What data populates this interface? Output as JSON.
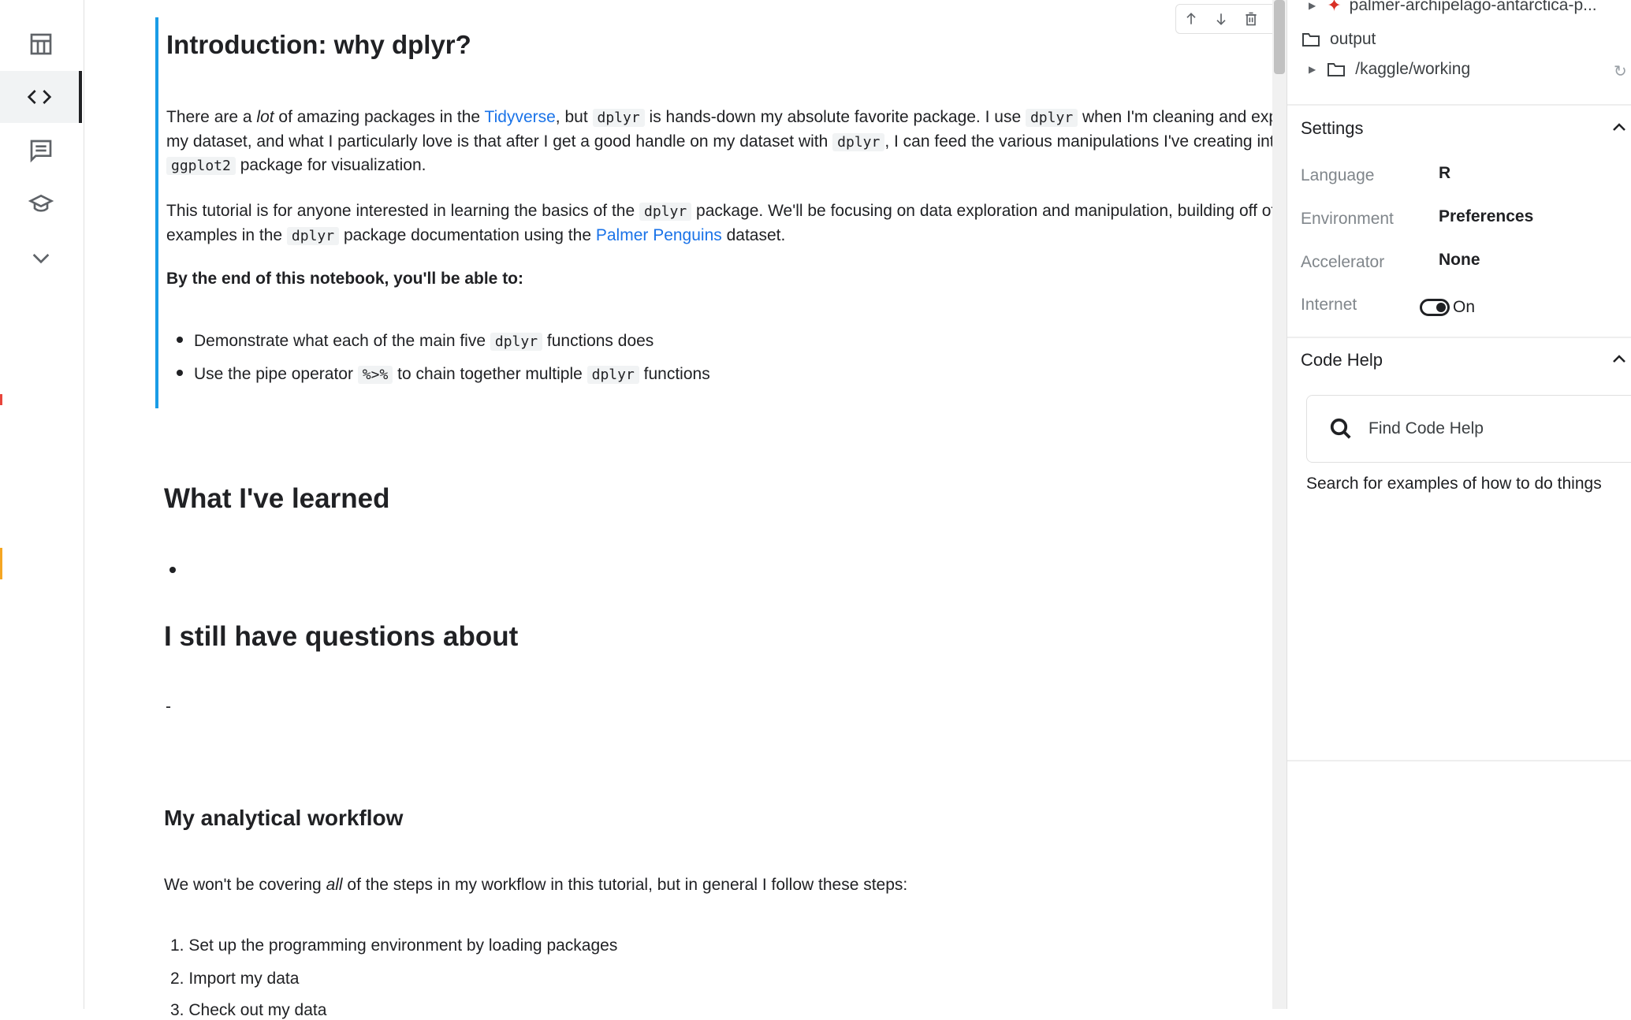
{
  "rail": {
    "items": [
      "table-icon",
      "code-icon",
      "comments-icon",
      "learn-icon",
      "expand-icon"
    ],
    "active": "code-icon"
  },
  "cell": {
    "toolbar": [
      "arrow-up-icon",
      "arrow-down-icon",
      "trash-icon",
      "collapse-icon",
      "more-icon"
    ],
    "title": "Introduction: why dplyr?",
    "p1": {
      "a": "There are a ",
      "em": "lot",
      "b": " of amazing packages in the ",
      "link1": "Tidyverse",
      "c": ", but ",
      "code1": "dplyr",
      "d": " is hands-down my absolute favorite package. I use ",
      "code2": "dplyr",
      "e": " when I'm cleaning and exploring my dataset, and what I particularly love is that after I get a good handle on my dataset with ",
      "code3": "dplyr",
      "f": ", I can feed the various manipulations I've creating into the ",
      "code4": "ggplot2",
      "g": " package for visualization."
    },
    "p2": {
      "a": "This tutorial is for anyone interested in learning the basics of the ",
      "code1": "dplyr",
      "b": " package. We'll be focusing on data exploration and manipulation, building off of the examples in the ",
      "code2": "dplyr",
      "c": " package documentation using the ",
      "link1": "Palmer Penguins",
      "d": " dataset."
    },
    "bold_line": "By the end of this notebook, you'll be able to:",
    "bullets": [
      {
        "a": "Demonstrate what each of the main five ",
        "code": "dplyr",
        "b": " functions does"
      },
      {
        "a": "Use the pipe operator ",
        "code": "%>%",
        "b": " to chain together multiple ",
        "code2": "dplyr",
        "c": " functions"
      }
    ]
  },
  "learned": {
    "title": "What I've learned"
  },
  "questions": {
    "title": "I still have questions about",
    "dash": "-"
  },
  "workflow": {
    "title": "My analytical workflow",
    "intro_a": "We won't be covering ",
    "intro_em": "all",
    "intro_b": " of the steps in my workflow in this tutorial, but in general I follow these steps:",
    "steps": [
      "1. Set up the programming environment by loading packages",
      "2. Import my data",
      "3. Check out my data"
    ]
  },
  "panel": {
    "tree": {
      "dataset": "palmer-archipelago-antarctica-p...",
      "output": "output",
      "working": "/kaggle/working"
    },
    "settings": {
      "title": "Settings",
      "language_label": "Language",
      "language_value": "R",
      "environment_label": "Environment",
      "environment_value": "Preferences",
      "accelerator_label": "Accelerator",
      "accelerator_value": "None",
      "internet_label": "Internet",
      "internet_value": "On"
    },
    "code_help": {
      "title": "Code Help",
      "placeholder": "Find Code Help",
      "help_text": "Search for examples of how to do things"
    }
  }
}
